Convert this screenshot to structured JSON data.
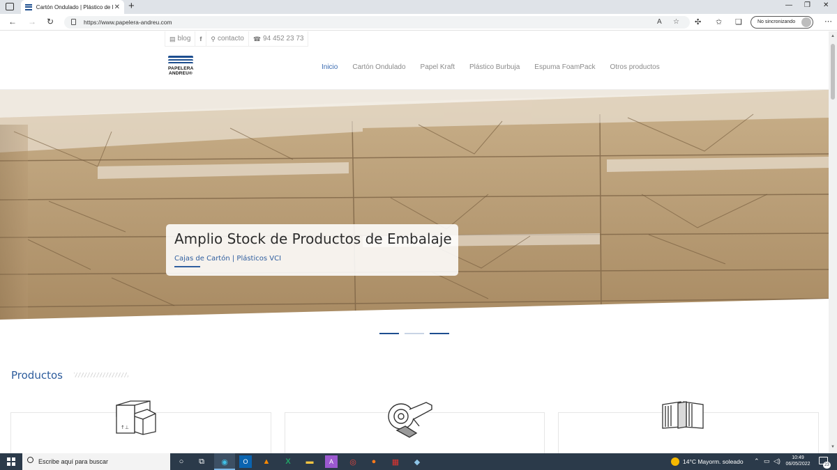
{
  "browser": {
    "tab_title": "Cartón Ondulado | Plástico de Bu",
    "url": "https://www.papelera-andreu.com",
    "sync_label": "No sincronizando"
  },
  "topbar": {
    "blog": "blog",
    "contact": "contacto",
    "phone": "94 452 23 73"
  },
  "logo": {
    "line1": "PAPELERA",
    "line2": "ANDREU®"
  },
  "nav": {
    "items": [
      "Inicio",
      "Cartón Ondulado",
      "Papel Kraft",
      "Plástico Burbuja",
      "Espuma FoamPack",
      "Otros productos"
    ],
    "active": "Inicio"
  },
  "hero": {
    "title": "Amplio Stock de Productos de Embalaje",
    "subtitle": "Cajas de Cartón | Plásticos VCI",
    "slide_count": 3,
    "active_slide": 1
  },
  "products": {
    "heading": "Productos",
    "cards": [
      {
        "icon": "boxes-icon"
      },
      {
        "icon": "tape-dispenser-icon"
      },
      {
        "icon": "corrugated-sheets-icon"
      }
    ]
  },
  "taskbar": {
    "search_placeholder": "Escribe aquí para buscar",
    "weather": "14°C  Mayorm. soleado",
    "time": "10:49",
    "date": "06/05/2022",
    "notifications": "23"
  },
  "colors": {
    "brand_blue": "#1d4e8f",
    "link_blue": "#2f5e9f",
    "taskbar": "#2b3a4a"
  }
}
